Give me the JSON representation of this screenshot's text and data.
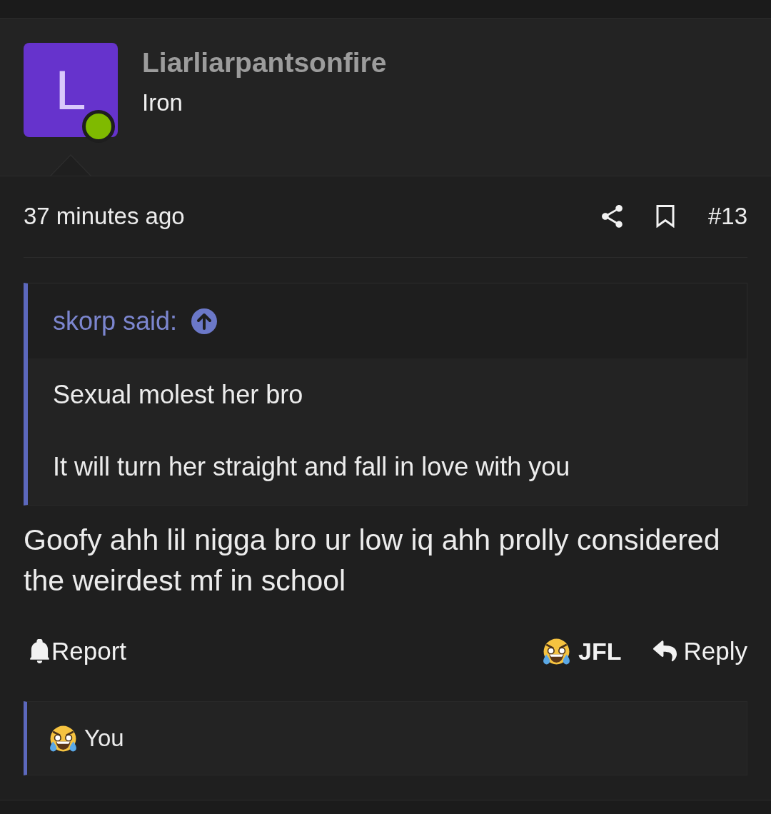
{
  "post": {
    "author": {
      "name": "Liarliarpantsonfire",
      "avatar_letter": "L",
      "online": true,
      "rank": "Iron"
    },
    "time": "37 minutes ago",
    "post_number": "#13",
    "quote": {
      "author_line": "skorp said:",
      "paragraphs": [
        "Sexual molest her bro",
        "It will turn her straight and fall in love with you"
      ]
    },
    "message": "Goofy ahh lil nigga bro ur low iq ahh prolly considered the weirdest mf in school",
    "actions": [
      {
        "kind": "report",
        "label": "Report"
      },
      {
        "kind": "reaction",
        "label": "JFL"
      },
      {
        "kind": "reply",
        "label": "Reply"
      }
    ],
    "reactions_bar": {
      "users": "You"
    }
  }
}
